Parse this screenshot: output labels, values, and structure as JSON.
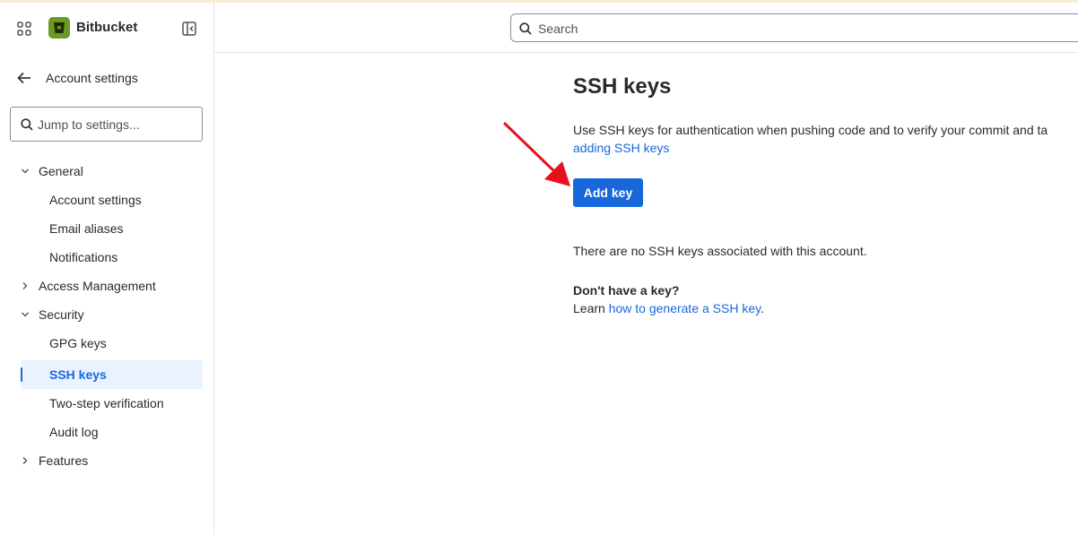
{
  "sidebar": {
    "brand": "Bitbucket",
    "back_label": "Account settings",
    "jump_placeholder": "Jump to settings...",
    "groups": [
      {
        "label": "General",
        "expanded": true,
        "items": [
          {
            "label": "Account settings"
          },
          {
            "label": "Email aliases"
          },
          {
            "label": "Notifications"
          }
        ]
      },
      {
        "label": "Access Management",
        "expanded": false
      },
      {
        "label": "Security",
        "expanded": true,
        "items": [
          {
            "label": "GPG keys"
          },
          {
            "label": "SSH keys",
            "active": true
          },
          {
            "label": "Two-step verification"
          },
          {
            "label": "Audit log"
          }
        ]
      },
      {
        "label": "Features",
        "expanded": false
      }
    ]
  },
  "topbar": {
    "search_placeholder": "Search"
  },
  "main": {
    "title": "SSH keys",
    "description": "Use SSH keys for authentication when pushing code and to verify your commit and ta",
    "description_link": "adding SSH keys",
    "add_button": "Add key",
    "empty_message": "There are no SSH keys associated with this account.",
    "no_key_title": "Don't have a key?",
    "learn_prefix": "Learn ",
    "learn_link": "how to generate a SSH key",
    "learn_suffix": "."
  },
  "colors": {
    "brand_green": "#6a9a23",
    "primary_blue": "#1868db",
    "active_bg": "#e9f2fe",
    "annotation_red": "#e8101c"
  },
  "icons": {
    "app_switcher": "grid-icon",
    "collapse": "sidebar-collapse-icon",
    "back": "arrow-left-icon",
    "search": "search-icon",
    "chevron_down": "chevron-down-icon",
    "chevron_right": "chevron-right-icon"
  }
}
